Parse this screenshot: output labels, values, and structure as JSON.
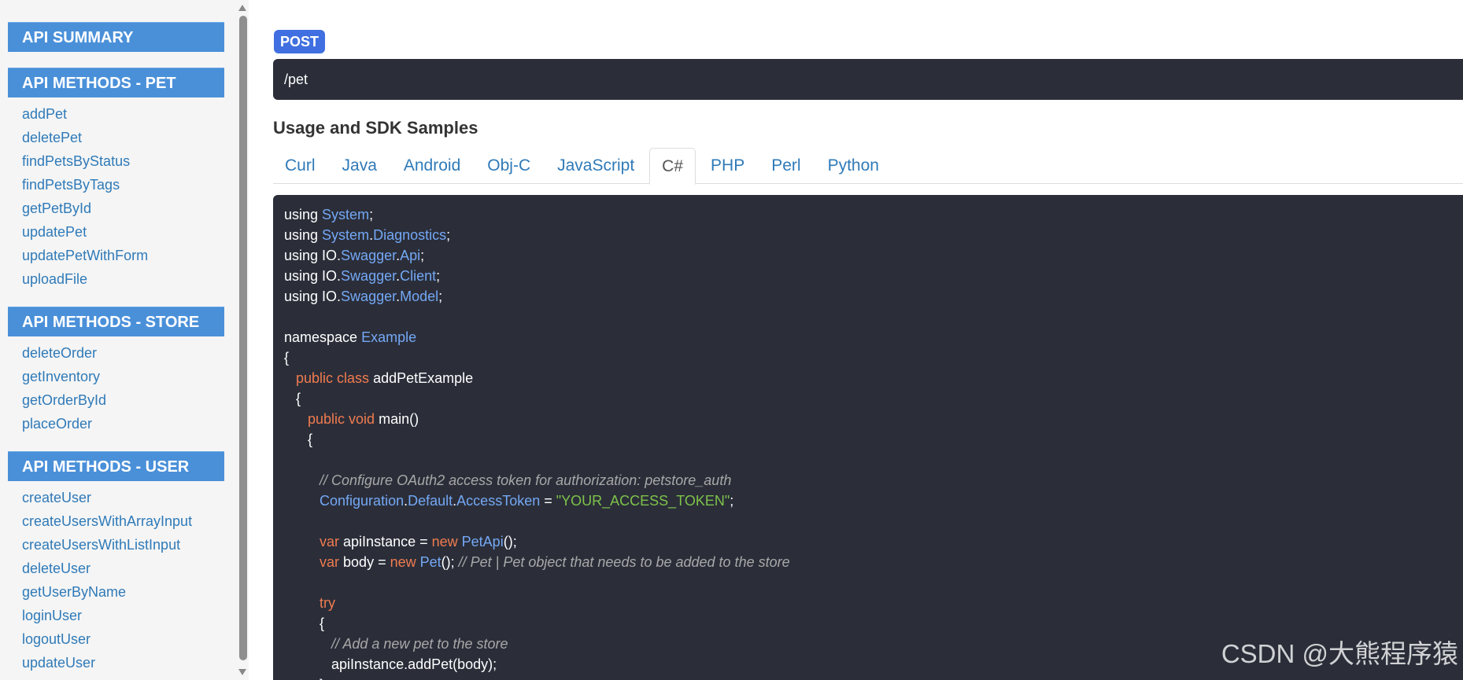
{
  "sidebar": {
    "summary_label": "API SUMMARY",
    "sections": [
      {
        "header": "API METHODS - PET",
        "items": [
          "addPet",
          "deletePet",
          "findPetsByStatus",
          "findPetsByTags",
          "getPetById",
          "updatePet",
          "updatePetWithForm",
          "uploadFile"
        ]
      },
      {
        "header": "API METHODS - STORE",
        "items": [
          "deleteOrder",
          "getInventory",
          "getOrderById",
          "placeOrder"
        ]
      },
      {
        "header": "API METHODS - USER",
        "items": [
          "createUser",
          "createUsersWithArrayInput",
          "createUsersWithListInput",
          "deleteUser",
          "getUserByName",
          "loginUser",
          "logoutUser",
          "updateUser"
        ]
      }
    ]
  },
  "main": {
    "method": "POST",
    "path": "/pet",
    "section_title": "Usage and SDK Samples",
    "tabs": [
      "Curl",
      "Java",
      "Android",
      "Obj-C",
      "JavaScript",
      "C#",
      "PHP",
      "Perl",
      "Python"
    ],
    "active_tab": "C#",
    "code_lines": [
      [
        [
          "using ",
          "p"
        ],
        [
          "System",
          "ty"
        ],
        [
          ";",
          "p"
        ]
      ],
      [
        [
          "using ",
          "p"
        ],
        [
          "System",
          "ty"
        ],
        [
          ".",
          "p"
        ],
        [
          "Diagnostics",
          "ty"
        ],
        [
          ";",
          "p"
        ]
      ],
      [
        [
          "using IO.",
          "p"
        ],
        [
          "Swagger",
          "ty"
        ],
        [
          ".",
          "p"
        ],
        [
          "Api",
          "ty"
        ],
        [
          ";",
          "p"
        ]
      ],
      [
        [
          "using IO.",
          "p"
        ],
        [
          "Swagger",
          "ty"
        ],
        [
          ".",
          "p"
        ],
        [
          "Client",
          "ty"
        ],
        [
          ";",
          "p"
        ]
      ],
      [
        [
          "using IO.",
          "p"
        ],
        [
          "Swagger",
          "ty"
        ],
        [
          ".",
          "p"
        ],
        [
          "Model",
          "ty"
        ],
        [
          ";",
          "p"
        ]
      ],
      [],
      [
        [
          "namespace ",
          "p"
        ],
        [
          "Example",
          "ty"
        ]
      ],
      [
        [
          "{",
          "p"
        ]
      ],
      [
        [
          "   ",
          "p"
        ],
        [
          "public class ",
          "kw"
        ],
        [
          "addPetExample",
          "p"
        ]
      ],
      [
        [
          "   {",
          "p"
        ]
      ],
      [
        [
          "      ",
          "p"
        ],
        [
          "public void ",
          "kw"
        ],
        [
          "main()",
          "p"
        ]
      ],
      [
        [
          "      {",
          "p"
        ]
      ],
      [],
      [
        [
          "         ",
          "p"
        ],
        [
          "// Configure OAuth2 access token for authorization: petstore_auth",
          "cmt"
        ]
      ],
      [
        [
          "         ",
          "p"
        ],
        [
          "Configuration",
          "ty"
        ],
        [
          ".",
          "p"
        ],
        [
          "Default",
          "ty"
        ],
        [
          ".",
          "p"
        ],
        [
          "AccessToken",
          "ty"
        ],
        [
          " = ",
          "p"
        ],
        [
          "\"YOUR_ACCESS_TOKEN\"",
          "str"
        ],
        [
          ";",
          "p"
        ]
      ],
      [],
      [
        [
          "         ",
          "p"
        ],
        [
          "var ",
          "kw"
        ],
        [
          "apiInstance = ",
          "p"
        ],
        [
          "new ",
          "kw"
        ],
        [
          "PetApi",
          "ty"
        ],
        [
          "();",
          "p"
        ]
      ],
      [
        [
          "         ",
          "p"
        ],
        [
          "var ",
          "kw"
        ],
        [
          "body = ",
          "p"
        ],
        [
          "new ",
          "kw"
        ],
        [
          "Pet",
          "ty"
        ],
        [
          "(); ",
          "p"
        ],
        [
          "// Pet | Pet object that needs to be added to the store",
          "cmt"
        ]
      ],
      [],
      [
        [
          "         ",
          "p"
        ],
        [
          "try",
          "kw"
        ]
      ],
      [
        [
          "         {",
          "p"
        ]
      ],
      [
        [
          "            ",
          "p"
        ],
        [
          "// Add a new pet to the store",
          "cmt"
        ]
      ],
      [
        [
          "            apiInstance.addPet(body);",
          "p"
        ]
      ],
      [
        [
          "         }",
          "p"
        ]
      ]
    ]
  },
  "watermark": "CSDN @大熊程序猿"
}
